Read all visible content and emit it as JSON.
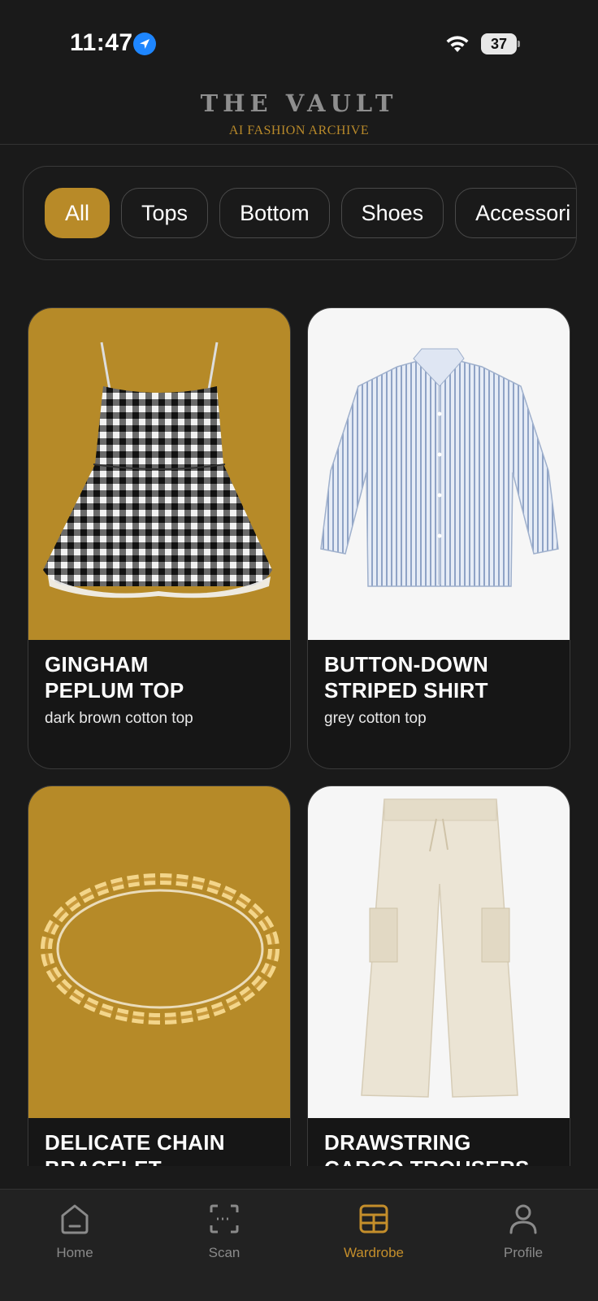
{
  "status_bar": {
    "time": "11:47",
    "battery": "37"
  },
  "header": {
    "title": "THE VAULT",
    "subtitle": "AI FASHION ARCHIVE"
  },
  "categories": [
    "All",
    "Tops",
    "Bottom",
    "Shoes",
    "Accessori"
  ],
  "active_category": "All",
  "items": [
    {
      "title": "GINGHAM PEPLUM TOP",
      "description": "dark brown cotton top",
      "image": "gingham-dress-image",
      "background": "#b68a28"
    },
    {
      "title": "BUTTON-DOWN STRIPED SHIRT",
      "description": "grey cotton top",
      "image": "striped-shirt-image",
      "background": "#f6f6f6"
    },
    {
      "title": "DELICATE CHAIN BRACELET",
      "description": "",
      "image": "gold-chain-bracelet-image",
      "background": "#b68a28"
    },
    {
      "title": "DRAWSTRING CARGO TROUSERS",
      "description": "",
      "image": "cargo-trousers-image",
      "background": "#f6f6f6"
    }
  ],
  "tab_bar": {
    "tabs": [
      {
        "label": "Home",
        "icon": "home-icon"
      },
      {
        "label": "Scan",
        "icon": "scan-icon"
      },
      {
        "label": "Wardrobe",
        "icon": "wardrobe-grid-icon"
      },
      {
        "label": "Profile",
        "icon": "profile-icon"
      }
    ],
    "active": "Wardrobe"
  },
  "colors": {
    "accent": "#b88a28",
    "background": "#1a1a1a",
    "location_blue": "#1e86ff"
  }
}
